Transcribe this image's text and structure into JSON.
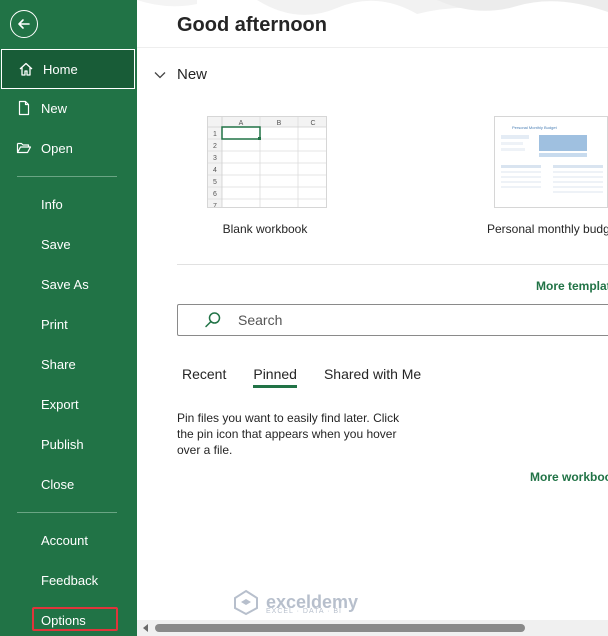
{
  "sidebar": {
    "home": "Home",
    "new": "New",
    "open": "Open",
    "info": "Info",
    "save": "Save",
    "save_as": "Save As",
    "print": "Print",
    "share": "Share",
    "export": "Export",
    "publish": "Publish",
    "close": "Close",
    "account": "Account",
    "feedback": "Feedback",
    "options": "Options"
  },
  "header": {
    "greeting": "Good afternoon"
  },
  "new_section": {
    "title": "New",
    "templates": [
      {
        "caption": "Blank workbook"
      },
      {
        "caption": "Personal monthly budg"
      }
    ],
    "blank_thumb": {
      "cols": [
        "A",
        "B",
        "C"
      ],
      "rows": [
        "1",
        "2",
        "3",
        "4",
        "5",
        "6",
        "7"
      ]
    },
    "budget_thumb_title": "Personal Monthly Budget",
    "more_templates": "More templat"
  },
  "search": {
    "placeholder": "Search"
  },
  "tabs": [
    {
      "label": "Recent"
    },
    {
      "label": "Pinned"
    },
    {
      "label": "Shared with Me"
    }
  ],
  "pinned_message": "Pin files you want to easily find later. Click the pin icon that appears when you hover over a file.",
  "more_workbooks": "More workboo",
  "watermark": {
    "name": "exceldemy",
    "sub": "EXCEL · DATA · BI"
  },
  "colors": {
    "accent": "#217346",
    "sidebar_active": "#185c37",
    "highlight_box": "#e0353b"
  }
}
